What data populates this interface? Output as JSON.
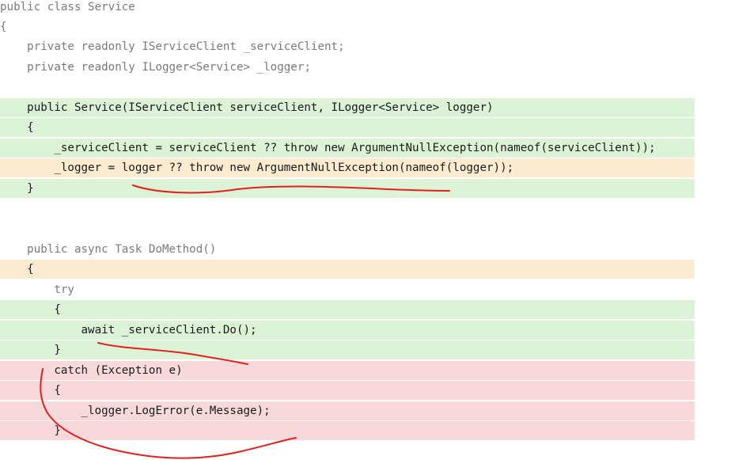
{
  "code": {
    "lines": [
      {
        "text": "public class Service",
        "coverage": "none"
      },
      {
        "text": "{",
        "coverage": "none"
      },
      {
        "text": "    private readonly IServiceClient _serviceClient;",
        "coverage": "none"
      },
      {
        "text": "    private readonly ILogger<Service> _logger;",
        "coverage": "none"
      },
      {
        "text": "",
        "coverage": "none"
      },
      {
        "text": "    public Service(IServiceClient serviceClient, ILogger<Service> logger)",
        "coverage": "covered"
      },
      {
        "text": "    {",
        "coverage": "covered"
      },
      {
        "text": "        _serviceClient = serviceClient ?? throw new ArgumentNullException(nameof(serviceClient));",
        "coverage": "covered"
      },
      {
        "text": "        _logger = logger ?? throw new ArgumentNullException(nameof(logger));",
        "coverage": "partial"
      },
      {
        "text": "    }",
        "coverage": "covered"
      },
      {
        "text": "",
        "coverage": "none"
      },
      {
        "text": "",
        "coverage": "none"
      },
      {
        "text": "    public async Task DoMethod()",
        "coverage": "none"
      },
      {
        "text": "    {",
        "coverage": "partial"
      },
      {
        "text": "        try",
        "coverage": "none"
      },
      {
        "text": "        {",
        "coverage": "covered"
      },
      {
        "text": "            await _serviceClient.Do();",
        "coverage": "covered"
      },
      {
        "text": "        }",
        "coverage": "covered"
      },
      {
        "text": "        catch (Exception e)",
        "coverage": "uncovered"
      },
      {
        "text": "        {",
        "coverage": "uncovered"
      },
      {
        "text": "            _logger.LogError(e.Message);",
        "coverage": "uncovered"
      },
      {
        "text": "        }",
        "coverage": "uncovered"
      }
    ]
  },
  "colors": {
    "covered": "#dcf3d8",
    "partial": "#fbebd0",
    "uncovered": "#f8d9db",
    "annotation": "#e0211c"
  },
  "annotations": [
    {
      "name": "underline-logger-null-check",
      "kind": "red-freehand-underline"
    },
    {
      "name": "underline-await-call",
      "kind": "red-freehand-underline"
    },
    {
      "name": "curve-around-catch-block",
      "kind": "red-freehand-curve"
    }
  ]
}
